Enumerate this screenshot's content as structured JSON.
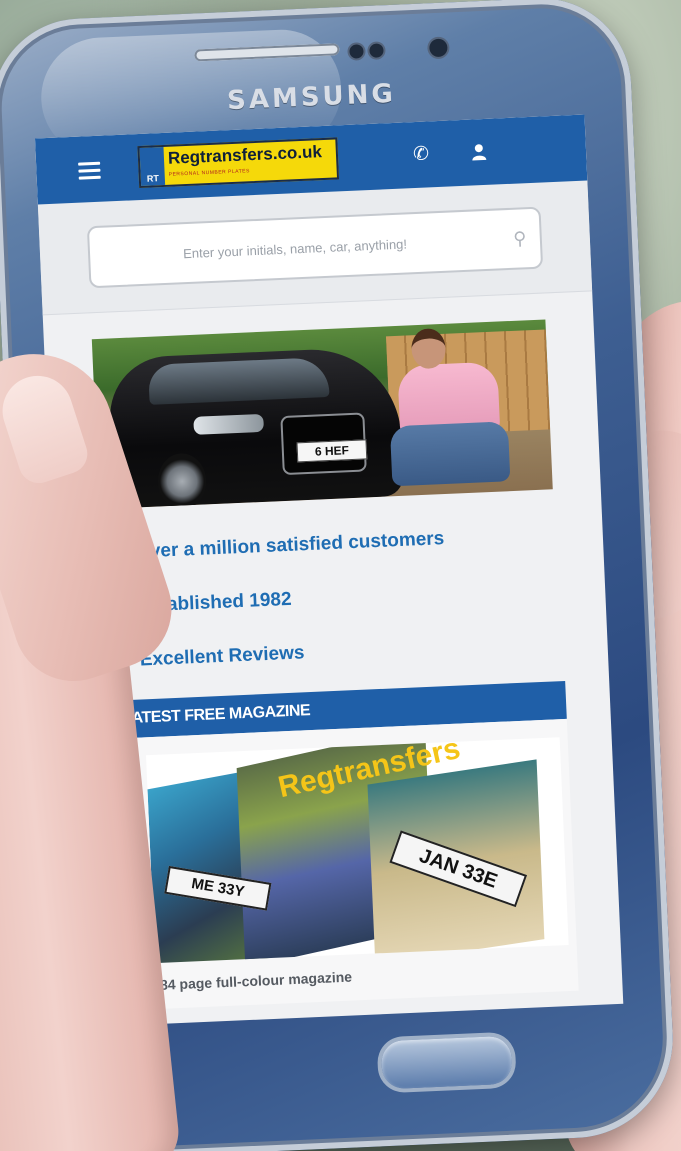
{
  "device": {
    "brand": "SAMSUNG"
  },
  "header": {
    "logo_text": "Regtransfers.co.uk",
    "logo_tagline": "PERSONAL NUMBER PLATES",
    "logo_mark": "RT",
    "phone_icon": "phone-icon",
    "account_icon": "user-icon",
    "menu_icon": "hamburger-menu-icon",
    "brand_color": "#1f5fa8",
    "logo_color": "#f5d90a"
  },
  "search": {
    "placeholder": "Enter your initials, name, car, anything!",
    "icon": "search-icon"
  },
  "hero": {
    "plate_text": "6 HEF"
  },
  "features": [
    {
      "icon": "star-icon",
      "label": "Over a million satisfied customers"
    },
    {
      "icon": "star-icon",
      "label": "Established 1982"
    },
    {
      "icon": "star-icon",
      "label": "Excellent Reviews"
    }
  ],
  "magazine": {
    "header": "LATEST FREE MAGAZINE",
    "title": "Regtransfers",
    "plate_1": "ME 33Y",
    "plate_2": "JAN 33E",
    "caption": "84 page full-colour magazine"
  }
}
